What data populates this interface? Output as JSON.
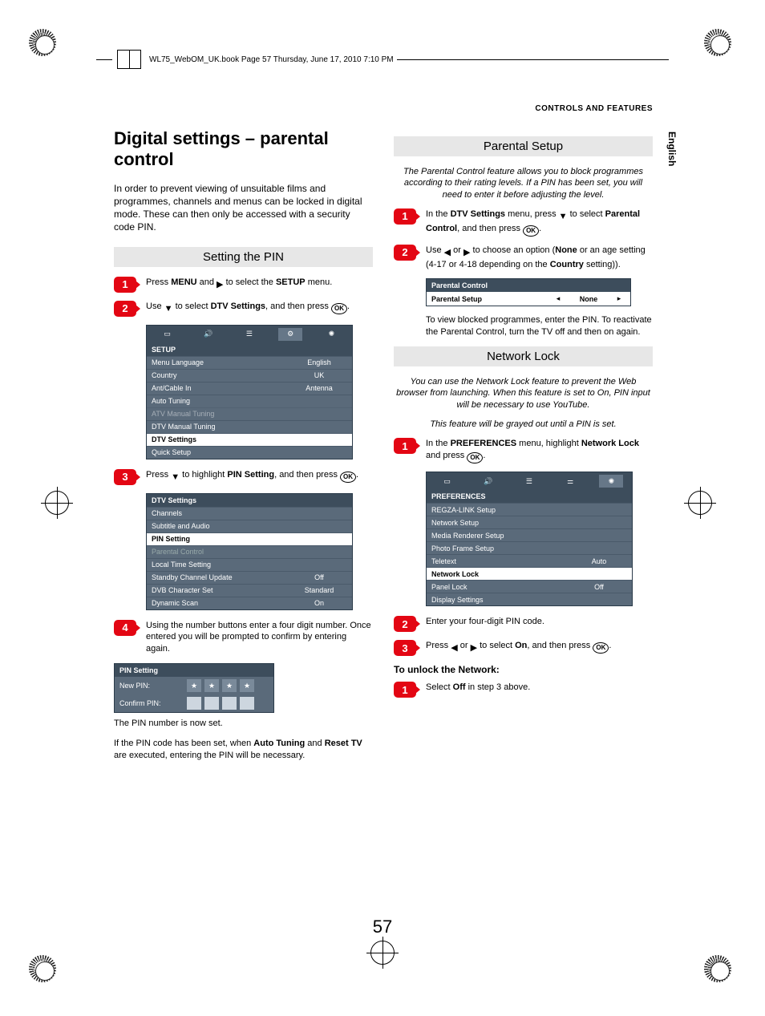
{
  "header": {
    "book_line": "WL75_WebOM_UK.book  Page 57  Thursday, June 17, 2010  7:10 PM",
    "section": "CONTROLS AND FEATURES",
    "lang_tab": "English"
  },
  "page_number": "57",
  "left": {
    "title": "Digital settings – parental control",
    "intro": "In order to prevent viewing of unsuitable films and programmes, channels and menus can be locked in digital mode. These can then only be accessed with a security code PIN.",
    "subhead1": "Setting the PIN",
    "step1": {
      "pre": "Press ",
      "b1": "MENU",
      "mid": " and ",
      "tri": "▶",
      "mid2": " to select the ",
      "b2": "SETUP",
      "post": " menu."
    },
    "step2": {
      "pre": "Use ",
      "tri": "▼",
      "mid": " to select ",
      "b1": "DTV Settings",
      "mid2": ", and then press ",
      "ok": "OK",
      "post": "."
    },
    "osd1": {
      "header": "SETUP",
      "rows": [
        {
          "l": "Menu Language",
          "v": "English",
          "hi": false
        },
        {
          "l": "Country",
          "v": "UK",
          "hi": false
        },
        {
          "l": "Ant/Cable In",
          "v": "Antenna",
          "hi": false
        },
        {
          "l": "Auto Tuning",
          "v": "",
          "hi": false
        },
        {
          "l": "ATV Manual Tuning",
          "v": "",
          "dim": true
        },
        {
          "l": "DTV Manual Tuning",
          "v": "",
          "hi": false
        },
        {
          "l": "DTV Settings",
          "v": "",
          "hi": true
        },
        {
          "l": "Quick Setup",
          "v": "",
          "hi": false
        }
      ]
    },
    "step3": {
      "pre": "Press ",
      "tri": "▼",
      "mid": " to highlight ",
      "b1": "PIN Setting",
      "mid2": ", and then press ",
      "ok": "OK",
      "post": "."
    },
    "osd2": {
      "header": "DTV Settings",
      "rows": [
        {
          "l": "Channels",
          "v": ""
        },
        {
          "l": "Subtitle and Audio",
          "v": ""
        },
        {
          "l": "PIN Setting",
          "v": "",
          "hi": true
        },
        {
          "l": "Parental Control",
          "v": "",
          "dim2": true
        },
        {
          "l": "Local Time Setting",
          "v": ""
        },
        {
          "l": "Standby Channel Update",
          "v": "Off"
        },
        {
          "l": "DVB Character Set",
          "v": "Standard"
        },
        {
          "l": "Dynamic Scan",
          "v": "On"
        }
      ]
    },
    "step4": "Using the number buttons enter a four digit number. Once entered you will be prompted to confirm by entering again.",
    "pin_osd": {
      "header": "PIN Setting",
      "new": "New PIN:",
      "confirm": "Confirm PIN:"
    },
    "after1": "The PIN number is now set.",
    "after2_pre": "If the PIN code has been set, when ",
    "after2_b1": "Auto Tuning",
    "after2_mid": " and ",
    "after2_b2": "Reset TV",
    "after2_post": " are executed, entering the PIN will be necessary."
  },
  "right": {
    "subhead1": "Parental Setup",
    "note1": "The Parental Control feature allows you to block programmes according to their rating levels. If a PIN has been set, you will need to enter it before adjusting the level.",
    "ps_step1": {
      "pre": "In the ",
      "b1": "DTV Settings",
      "mid": " menu, press ",
      "tri": "▼",
      "mid2": " to select ",
      "b2": "Parental Control",
      "mid3": ", and then press ",
      "ok": "OK",
      "post": "."
    },
    "ps_step2": {
      "pre": "Use ",
      "tri1": "◀",
      "or": " or ",
      "tri2": "▶",
      "mid": " to choose an option (",
      "b1": "None",
      "mid2": " or an age setting (4-17 or 4-18 depending on the ",
      "b2": "Country",
      "post": " setting))."
    },
    "parental_box": {
      "header": "Parental Control",
      "row_l": "Parental Setup",
      "row_v": "None"
    },
    "ps_after": "To view blocked programmes, enter the PIN. To reactivate the Parental Control, turn the TV off and then on again.",
    "subhead2": "Network Lock",
    "note2": "You can use the Network Lock feature to prevent the Web browser from launching. When this feature is set to On, PIN input will be necessary to use YouTube.",
    "note2b": "This feature will be grayed out until a PIN is set.",
    "nl_step1": {
      "pre": "In the ",
      "b1": "PREFERENCES",
      "mid": " menu, highlight ",
      "b2": "Network Lock",
      "mid2": " and press ",
      "ok": "OK",
      "post": "."
    },
    "osd3": {
      "header": "PREFERENCES",
      "rows": [
        {
          "l": "REGZA-LINK Setup",
          "v": ""
        },
        {
          "l": "Network Setup",
          "v": ""
        },
        {
          "l": "Media Renderer Setup",
          "v": ""
        },
        {
          "l": "Photo Frame Setup",
          "v": ""
        },
        {
          "l": "Teletext",
          "v": "Auto"
        },
        {
          "l": "Network Lock",
          "v": "",
          "hi": true
        },
        {
          "l": "Panel Lock",
          "v": "Off"
        },
        {
          "l": "Display Settings",
          "v": ""
        }
      ]
    },
    "nl_step2": "Enter your four-digit PIN code.",
    "nl_step3": {
      "pre": "Press ",
      "tri1": "◀",
      "or": " or ",
      "tri2": "▶",
      "mid": " to select ",
      "b1": "On",
      "mid2": ", and then press ",
      "ok": "OK",
      "post": "."
    },
    "unlock_h": "To unlock the Network:",
    "unlock_step": {
      "pre": "Select ",
      "b1": "Off",
      "post": " in step 3 above."
    }
  }
}
